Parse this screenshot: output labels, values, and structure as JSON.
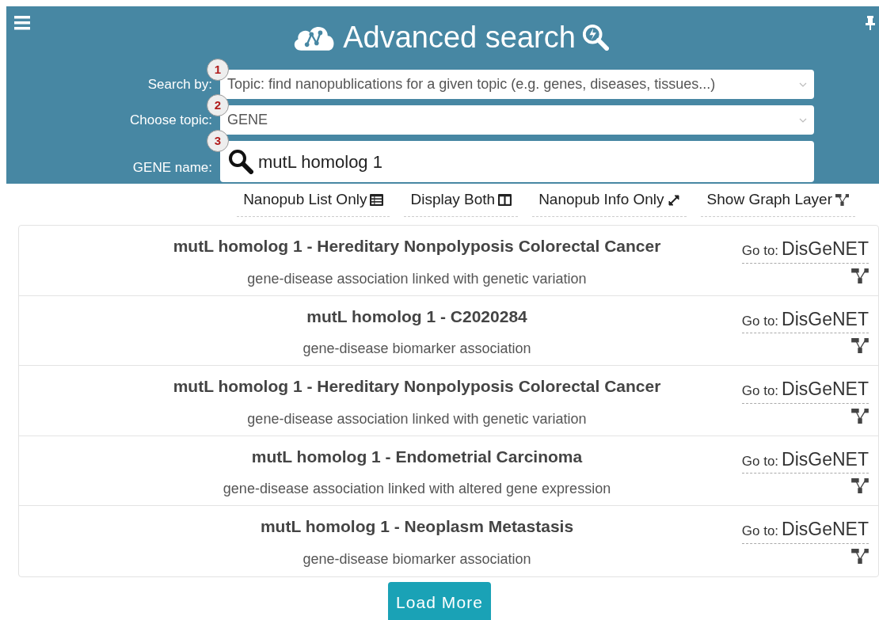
{
  "header": {
    "title": "Advanced search"
  },
  "form": [
    {
      "step": "1",
      "label": "Search by:",
      "kind": "select",
      "value": "Topic: find nanopublications for a given topic (e.g. genes, diseases, tissues...)"
    },
    {
      "step": "2",
      "label": "Choose topic:",
      "kind": "select",
      "value": "GENE"
    },
    {
      "step": "3",
      "label": "GENE name:",
      "kind": "search",
      "value": "mutL homolog 1"
    }
  ],
  "view_buttons": [
    {
      "label": "Nanopub List Only",
      "kind": "list"
    },
    {
      "label": "Display Both",
      "kind": "columns"
    },
    {
      "label": "Nanopub Info Only",
      "kind": "expand"
    },
    {
      "label": "Show Graph Layer",
      "kind": "graph"
    }
  ],
  "results": [
    {
      "title": "mutL homolog 1 - Hereditary Nonpolyposis Colorectal Cancer",
      "subtitle": "gene-disease association linked with genetic variation",
      "goto_label": "Go to:",
      "link": "DisGeNET"
    },
    {
      "title": "mutL homolog 1 - C2020284",
      "subtitle": "gene-disease biomarker association",
      "goto_label": "Go to:",
      "link": "DisGeNET"
    },
    {
      "title": "mutL homolog 1 - Hereditary Nonpolyposis Colorectal Cancer",
      "subtitle": "gene-disease association linked with genetic variation",
      "goto_label": "Go to:",
      "link": "DisGeNET"
    },
    {
      "title": "mutL homolog 1 - Endometrial Carcinoma",
      "subtitle": "gene-disease association linked with altered gene expression",
      "goto_label": "Go to:",
      "link": "DisGeNET"
    },
    {
      "title": "mutL homolog 1 - Neoplasm Metastasis",
      "subtitle": "gene-disease biomarker association",
      "goto_label": "Go to:",
      "link": "DisGeNET"
    }
  ],
  "load_more": "Load More"
}
